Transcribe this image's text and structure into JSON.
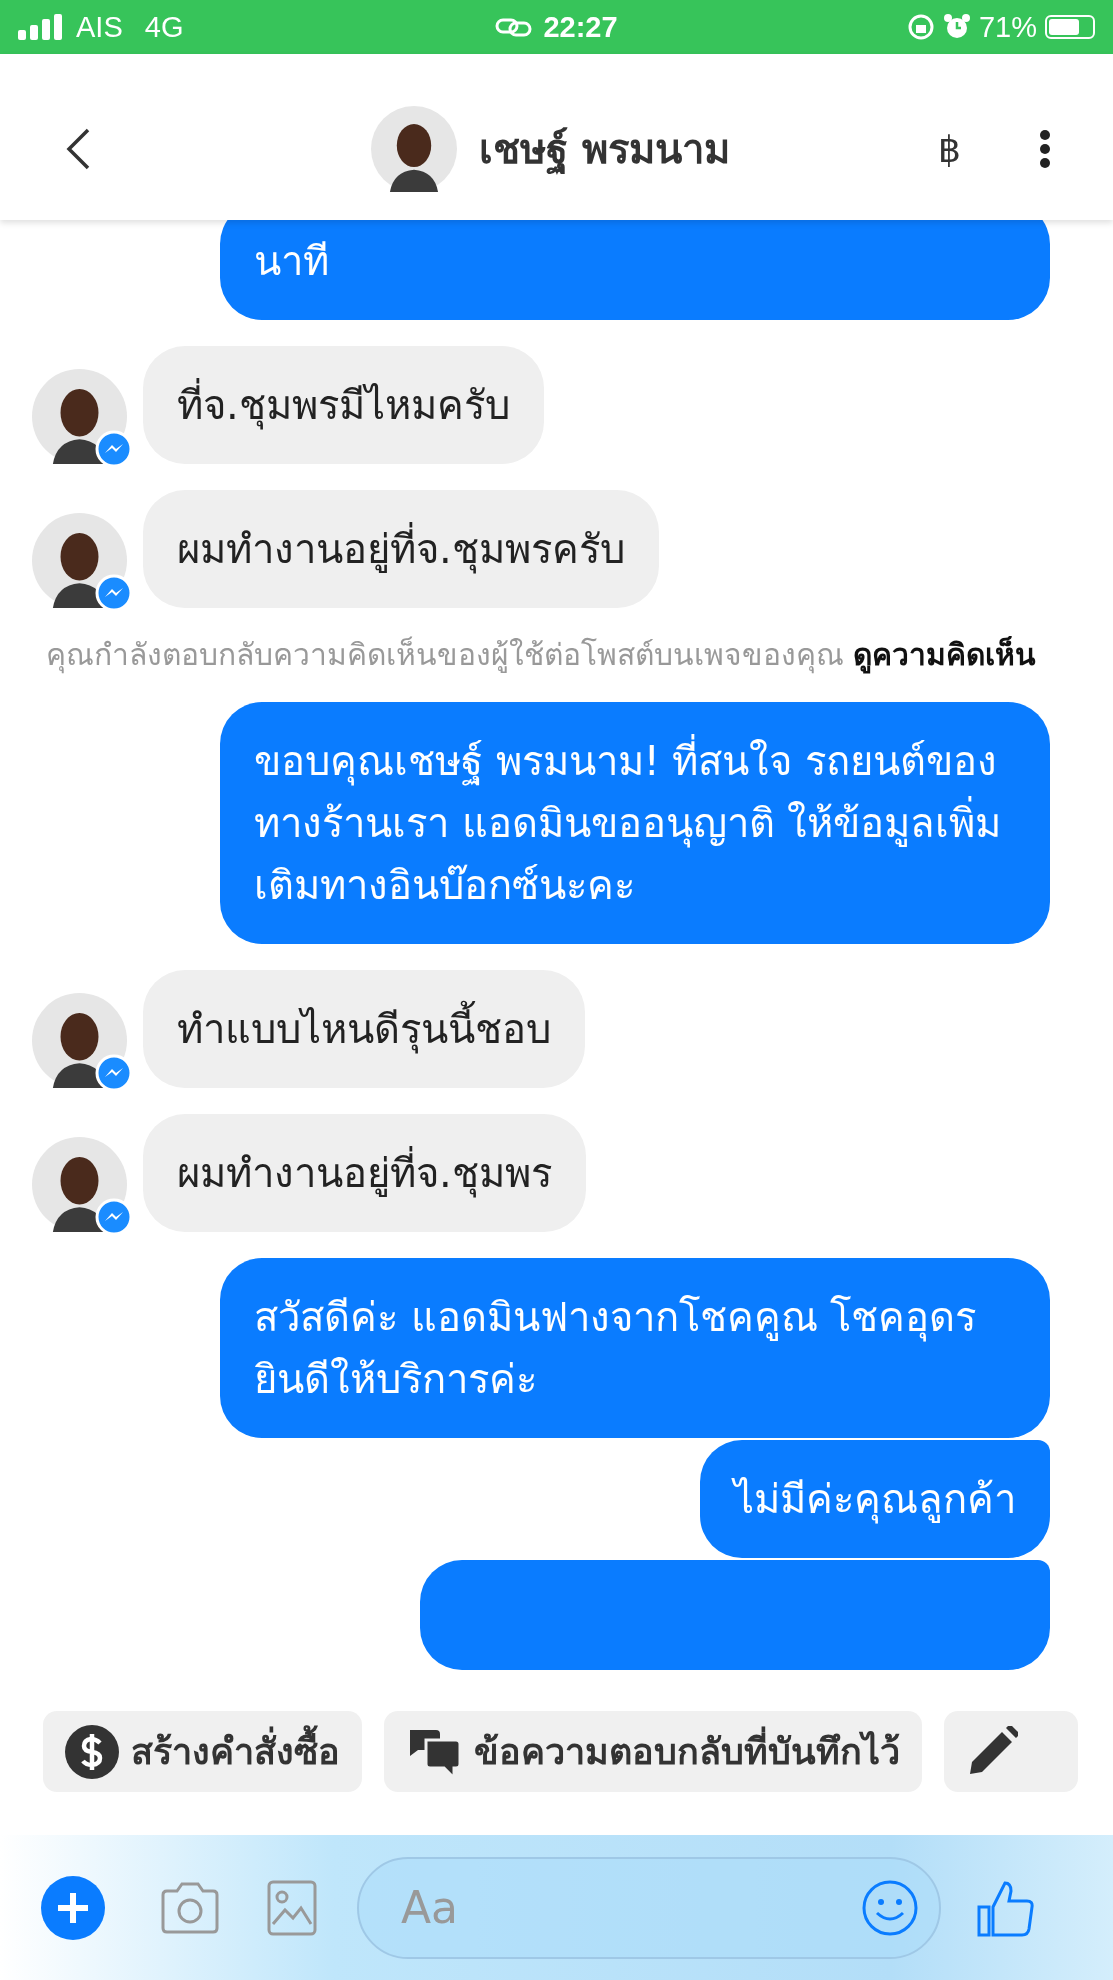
{
  "status_bar": {
    "carrier": "AIS",
    "network": "4G",
    "time": "22:27",
    "battery": "71%"
  },
  "header": {
    "name": "เชษฐ์ พรมนาม",
    "currency": "฿"
  },
  "messages": [
    {
      "kind": "continued",
      "text": "นาที"
    },
    {
      "kind": "incoming",
      "text": "ที่จ.ชุมพรมีไหมครับ"
    },
    {
      "kind": "incoming",
      "text": "ผมทำงานอยู่ที่จ.ชุมพรครับ"
    },
    {
      "kind": "notice",
      "text": "คุณกำลังตอบกลับความคิดเห็นของผู้ใช้ต่อโพสต์บนเพจของคุณ",
      "link": "ดูความคิดเห็น"
    },
    {
      "kind": "outgoing",
      "text": "ขอบคุณเชษฐ์ พรมนาม! ที่สนใจ รถยนต์ของทางร้านเรา แอดมินขออนุญาติ ให้ข้อมูลเพิ่มเติมทางอินบ๊อกซ์นะคะ"
    },
    {
      "kind": "incoming",
      "text": "ทำแบบไหนดีรุนนี้ชอบ"
    },
    {
      "kind": "incoming",
      "text": "ผมทำงานอยู่ที่จ.ชุมพร"
    },
    {
      "kind": "outgoing",
      "text": "สวัสดีค่ะ แอดมินฟางจากโชคคูณ โชคอุดร ยินดีให้บริการค่ะ"
    },
    {
      "kind": "outgoing",
      "text": "ไม่มีค่ะคุณลูกค้า"
    },
    {
      "kind": "clipped"
    }
  ],
  "quick_replies": [
    "สร้างคำสั่งซื้อ",
    "ข้อความตอบกลับที่บันทึกไว้"
  ],
  "composer": {
    "placeholder": "Aa"
  }
}
